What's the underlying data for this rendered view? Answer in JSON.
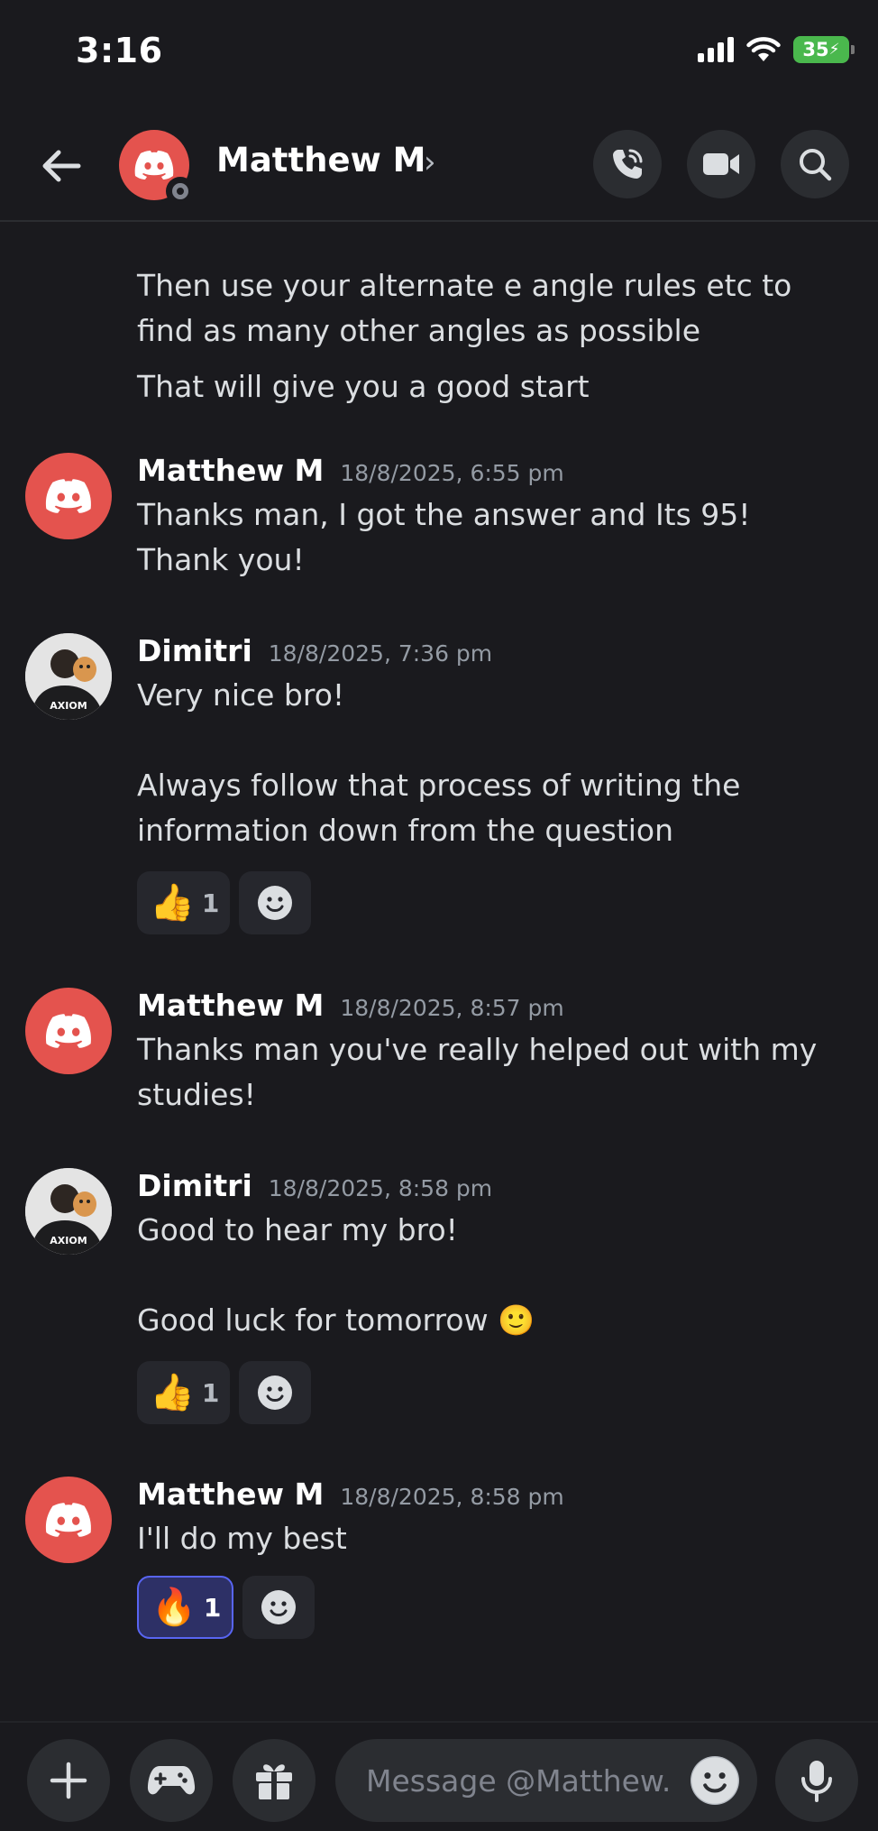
{
  "status_bar": {
    "time": "3:16",
    "battery": "35"
  },
  "header": {
    "name": "Matthew M",
    "chevron": "›"
  },
  "continued_lines": [
    "Then use your alternate e angle rules etc to find as many other angles as possible",
    "That will give you a good start"
  ],
  "messages": [
    {
      "author": "Matthew M",
      "timestamp": "18/8/2025, 6:55 pm",
      "lines": [
        "Thanks man, I got the answer and Its 95! Thank you!"
      ]
    },
    {
      "author": "Dimitri",
      "timestamp": "18/8/2025, 7:36 pm",
      "lines": [
        "Very nice bro!",
        "",
        "Always follow that process of writing the information down from the question"
      ],
      "reaction": {
        "emoji": "👍",
        "count": "1"
      }
    },
    {
      "author": "Matthew M",
      "timestamp": "18/8/2025, 8:57 pm",
      "lines": [
        "Thanks man you've really helped out with my studies!"
      ]
    },
    {
      "author": "Dimitri",
      "timestamp": "18/8/2025, 8:58 pm",
      "lines": [
        "Good to hear my bro!",
        "",
        "Good luck for tomorrow 🙂"
      ],
      "reaction": {
        "emoji": "👍",
        "count": "1"
      }
    },
    {
      "author": "Matthew M",
      "timestamp": "18/8/2025, 8:58 pm",
      "lines": [
        "I'll do my best"
      ],
      "reaction": {
        "emoji": "🔥",
        "count": "1"
      }
    }
  ],
  "avatar_text": "AXIOM",
  "input": {
    "placeholder": "Message @Matthew.."
  },
  "icons": {
    "back": "arrow-left-icon",
    "call": "phone-call-icon",
    "video": "video-camera-icon",
    "search": "search-icon",
    "plus": "plus-icon",
    "games": "gamepad-icon",
    "gift": "gift-icon",
    "emoji": "smiley-icon",
    "mic": "microphone-icon"
  },
  "colors": {
    "background": "#1a1a1e",
    "discord_red": "#e4534e",
    "blurple": "#5865f2",
    "battery_green": "#4ab84d"
  }
}
